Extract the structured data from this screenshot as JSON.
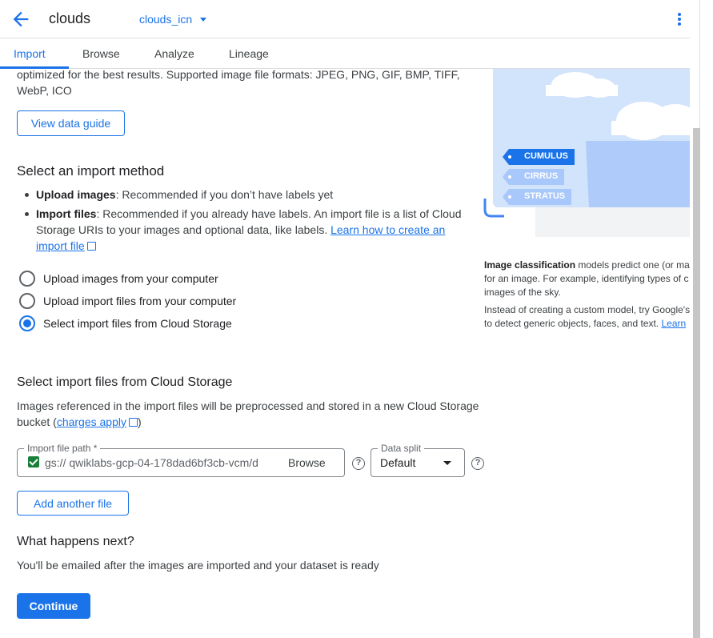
{
  "header": {
    "title": "clouds",
    "dataset": "clouds_icn"
  },
  "tabs": [
    "Import",
    "Browse",
    "Analyze",
    "Lineage"
  ],
  "intro": {
    "text": "optimized for the best results. Supported image file formats: JPEG, PNG, GIF, BMP, TIFF, WebP, ICO",
    "guide_button": "View data guide"
  },
  "method": {
    "heading": "Select an import method",
    "bullets": [
      {
        "bold": "Upload images",
        "text": ": Recommended if you don’t have labels yet"
      },
      {
        "bold": "Import files",
        "text": ": Recommended if you already have labels. An import file is a list of Cloud Storage URIs to your images and optional data, like labels. ",
        "link": "Learn how to create an import file"
      }
    ],
    "options": [
      {
        "label": "Upload images from your computer",
        "selected": false
      },
      {
        "label": "Upload import files from your computer",
        "selected": false
      },
      {
        "label": "Select import files from Cloud Storage",
        "selected": true
      }
    ]
  },
  "cloud_storage": {
    "heading": "Select import files from Cloud Storage",
    "desc": "Images referenced in the import files will be preprocessed and stored in a new Cloud Storage bucket (",
    "desc_link": "charges apply",
    "desc_end": ")",
    "path_label": "Import file path *",
    "path_value": "gs:// qwiklabs-gcp-04-178dad6bf3cb-vcm/d",
    "browse": "Browse",
    "split_label": "Data split",
    "split_value": "Default",
    "add_button": "Add another file"
  },
  "next": {
    "heading": "What happens next?",
    "text": "You'll be emailed after the images are imported and your dataset is ready",
    "continue": "Continue"
  },
  "side": {
    "tags": [
      "CUMULUS",
      "CIRRUS",
      "STRATUS"
    ],
    "p1_bold": "Image classification",
    "p1_line1": " models predict one (or mar",
    "p1_line2": "for an image. For example, identifying types of c",
    "p1_line3": "images of the sky.",
    "p2_line1": "Instead of creating a custom model, try Google's",
    "p2_line2": "to detect generic objects, faces, and text. ",
    "p2_link": "Learn"
  },
  "colors": {
    "accent": "#1a73e8",
    "checkbox": "#188038"
  }
}
